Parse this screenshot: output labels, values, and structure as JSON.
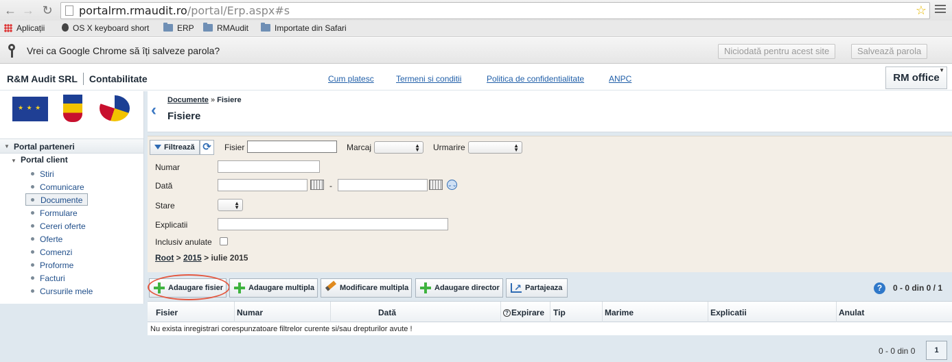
{
  "browser": {
    "url_host": "portalrm.rmaudit.ro",
    "url_path": "/portal/Erp.aspx#s",
    "bookmarks": [
      "Aplicații",
      "OS X keyboard short",
      "ERP",
      "RMAudit",
      "Importate din Safari"
    ],
    "infobar": {
      "message": "Vrei ca Google Chrome să îți salveze parola?",
      "never_label": "Niciodată pentru acest site",
      "save_label": "Salvează parola"
    }
  },
  "header": {
    "company": "R&M Audit SRL",
    "module": "Contabilitate",
    "links": [
      "Cum platesc",
      "Termeni si conditii",
      "Politica de confidentialitate",
      "ANPC"
    ],
    "office_button": "RM office"
  },
  "sidebar": {
    "section": "Portal parteneri",
    "subsection": "Portal client",
    "items": [
      "Stiri",
      "Comunicare",
      "Documente",
      "Formulare",
      "Cereri oferte",
      "Oferte",
      "Comenzi",
      "Proforme",
      "Facturi",
      "Cursurile mele"
    ],
    "active": "Documente"
  },
  "content": {
    "breadcrumb_link": "Documente",
    "breadcrumb_sep": "»",
    "breadcrumb_current": "Fisiere",
    "title": "Fisiere"
  },
  "filter": {
    "filter_button": "Filtrează",
    "fisier_label": "Fisier",
    "fisier_value": "",
    "marcaj_label": "Marcaj",
    "urmarire_label": "Urmarire",
    "numar_label": "Numar",
    "data_label": "Dată",
    "data_sep": "-",
    "stare_label": "Stare",
    "explicatii_label": "Explicatii",
    "inclusiv_label": "Inclusiv anulate",
    "path_root": "Root",
    "path_sep1": ">",
    "path_year": "2015",
    "path_sep2": ">",
    "path_month": "iulie 2015"
  },
  "actions": {
    "add_file": "Adaugare fisier",
    "add_multiple": "Adaugare multipla",
    "edit_multiple": "Modificare multipla",
    "add_folder": "Adaugare director",
    "share": "Partajeaza",
    "pager": "0 - 0 din 0 /  1"
  },
  "grid": {
    "columns": [
      "Fisier",
      "Numar",
      "Dată",
      "Expirare",
      "Tip",
      "Marime",
      "Explicatii",
      "Anulat"
    ],
    "empty_message": "Nu exista inregistrari corespunzatoare filtrelor curente si/sau drepturilor avute !"
  },
  "footer": {
    "pager": "0 - 0 din 0",
    "page": "1"
  }
}
